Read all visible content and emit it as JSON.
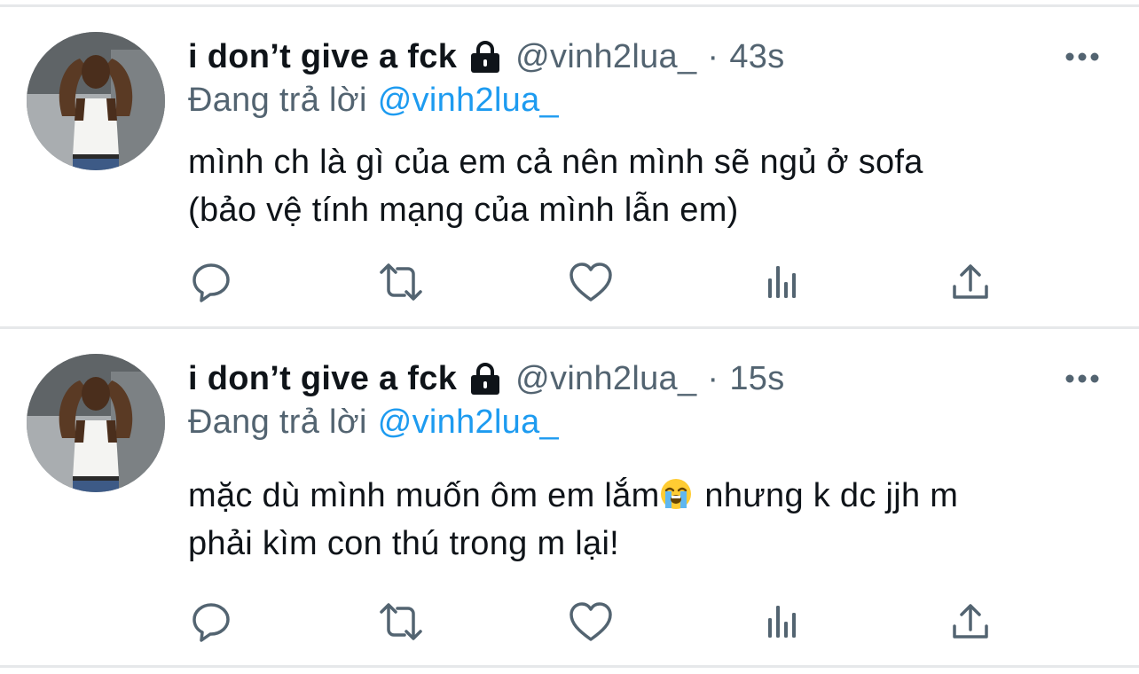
{
  "tweets": [
    {
      "display_name": "i don’t give a fck",
      "handle": "@vinh2lua_",
      "separator": "·",
      "time": "43s",
      "reply_prefix": "Đang trả lời",
      "reply_to": "@vinh2lua_",
      "text_line1": "mình ch là gì của em cả nên mình sẽ ngủ ở sofa",
      "text_line2": "(bảo vệ tính mạng của mình lẫn em)"
    },
    {
      "display_name": "i don’t give a fck",
      "handle": "@vinh2lua_",
      "separator": "·",
      "time": "15s",
      "reply_prefix": "Đang trả lời",
      "reply_to": "@vinh2lua_",
      "text_line1_a": "mặc dù mình muốn ôm em lắm",
      "text_line1_b": " nhưng k dc jjh m",
      "text_line2": "phải kìm con thú trong m lại!",
      "emoji": "loudly-crying-face"
    }
  ],
  "icons": {
    "lock": "lock-icon",
    "more": "more-icon",
    "reply": "reply-icon",
    "retweet": "retweet-icon",
    "like": "like-icon",
    "views": "views-icon",
    "share": "share-icon"
  },
  "colors": {
    "text": "#0f1419",
    "muted": "#536471",
    "link": "#1d9bf0",
    "divider": "#e6e8ea"
  }
}
